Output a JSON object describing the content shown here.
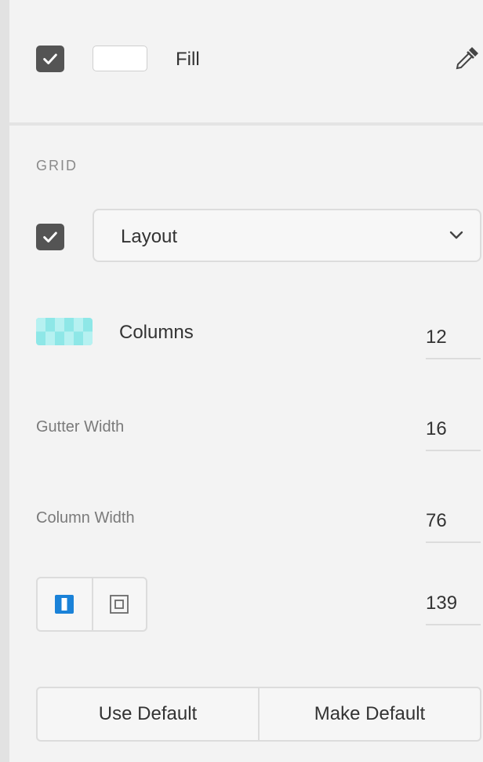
{
  "fill": {
    "label": "Fill",
    "checked": true,
    "swatch_color": "#ffffff"
  },
  "grid": {
    "section_title": "GRID",
    "enabled": true,
    "type_value": "Layout",
    "columns_label": "Columns",
    "columns_value": "12",
    "columns_swatch_color": "#8ee7e7",
    "gutter_label": "Gutter Width",
    "gutter_value": "16",
    "column_width_label": "Column Width",
    "column_width_value": "76",
    "margin_value": "139",
    "accent_color": "#1a82d8"
  },
  "buttons": {
    "use_default": "Use Default",
    "make_default": "Make Default"
  },
  "icons": {
    "checkbox": "check-icon",
    "eyedropper": "eyedropper-icon",
    "chevron": "chevron-down-icon",
    "linked_margins": "linked-margins-icon",
    "different_margins": "different-margins-icon"
  }
}
